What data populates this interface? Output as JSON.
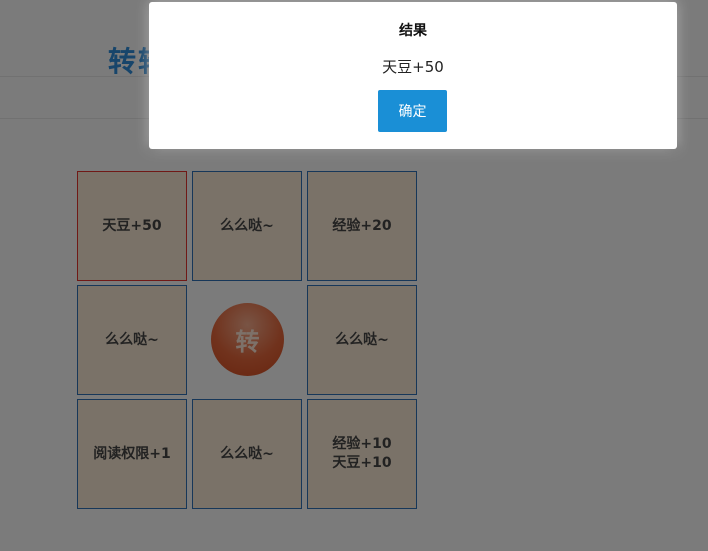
{
  "page": {
    "title": "转轮"
  },
  "grid": {
    "cells": [
      {
        "label": "天豆+50"
      },
      {
        "label": "么么哒~"
      },
      {
        "label": "经验+20"
      },
      {
        "label": "么么哒~"
      },
      {
        "label": "么么哒~"
      },
      {
        "label": "阅读权限+1"
      },
      {
        "label": "么么哒~"
      },
      {
        "label_line1": "经验+10",
        "label_line2": "天豆+10"
      }
    ],
    "active_index": 0,
    "spin_button_label": "转"
  },
  "dialog": {
    "title": "结果",
    "message": "天豆+50",
    "confirm_label": "确定"
  },
  "colors": {
    "accent": "#1a8fd6",
    "title_blue": "#2e8bd6",
    "cell_border": "#2f6fb3",
    "active_border": "#e0322c",
    "cell_fill": "#f4e4d0",
    "spin_button": "#e2653a"
  }
}
